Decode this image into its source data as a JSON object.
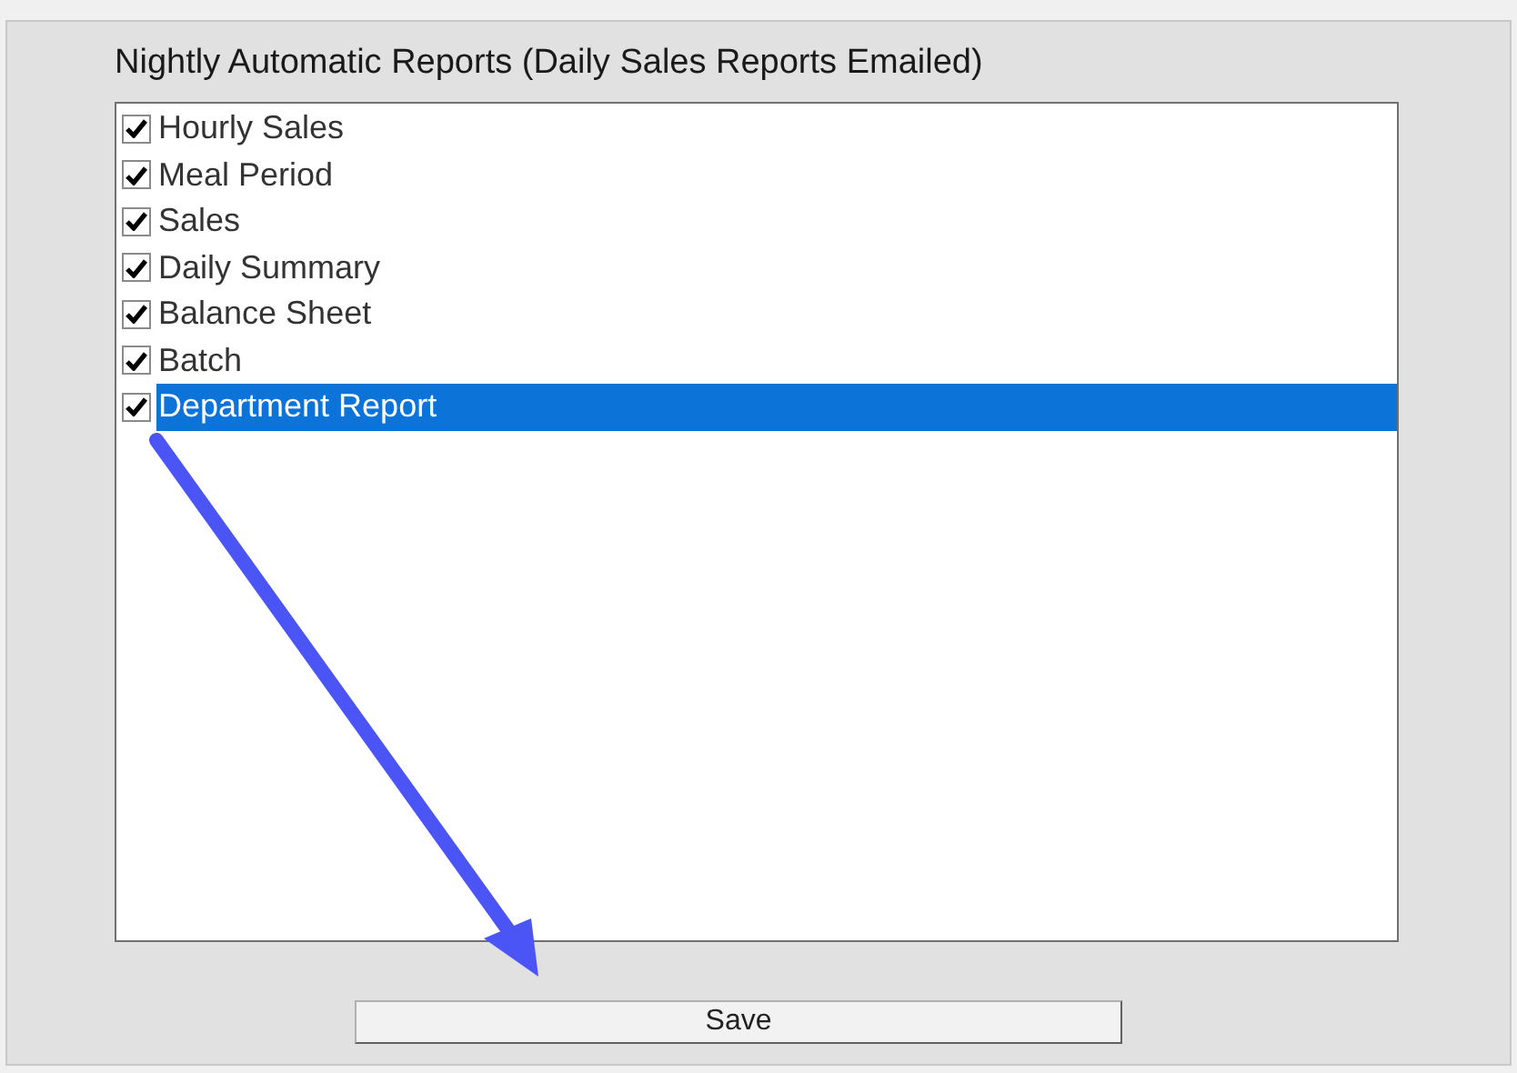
{
  "title": "Nightly Automatic Reports (Daily Sales Reports Emailed)",
  "reports": [
    {
      "label": "Hourly Sales",
      "checked": true,
      "selected": false
    },
    {
      "label": "Meal Period",
      "checked": true,
      "selected": false
    },
    {
      "label": "Sales",
      "checked": true,
      "selected": false
    },
    {
      "label": "Daily Summary",
      "checked": true,
      "selected": false
    },
    {
      "label": "Balance Sheet",
      "checked": true,
      "selected": false
    },
    {
      "label": "Batch",
      "checked": true,
      "selected": false
    },
    {
      "label": "Department Report",
      "checked": true,
      "selected": true
    }
  ],
  "save_button": "Save"
}
